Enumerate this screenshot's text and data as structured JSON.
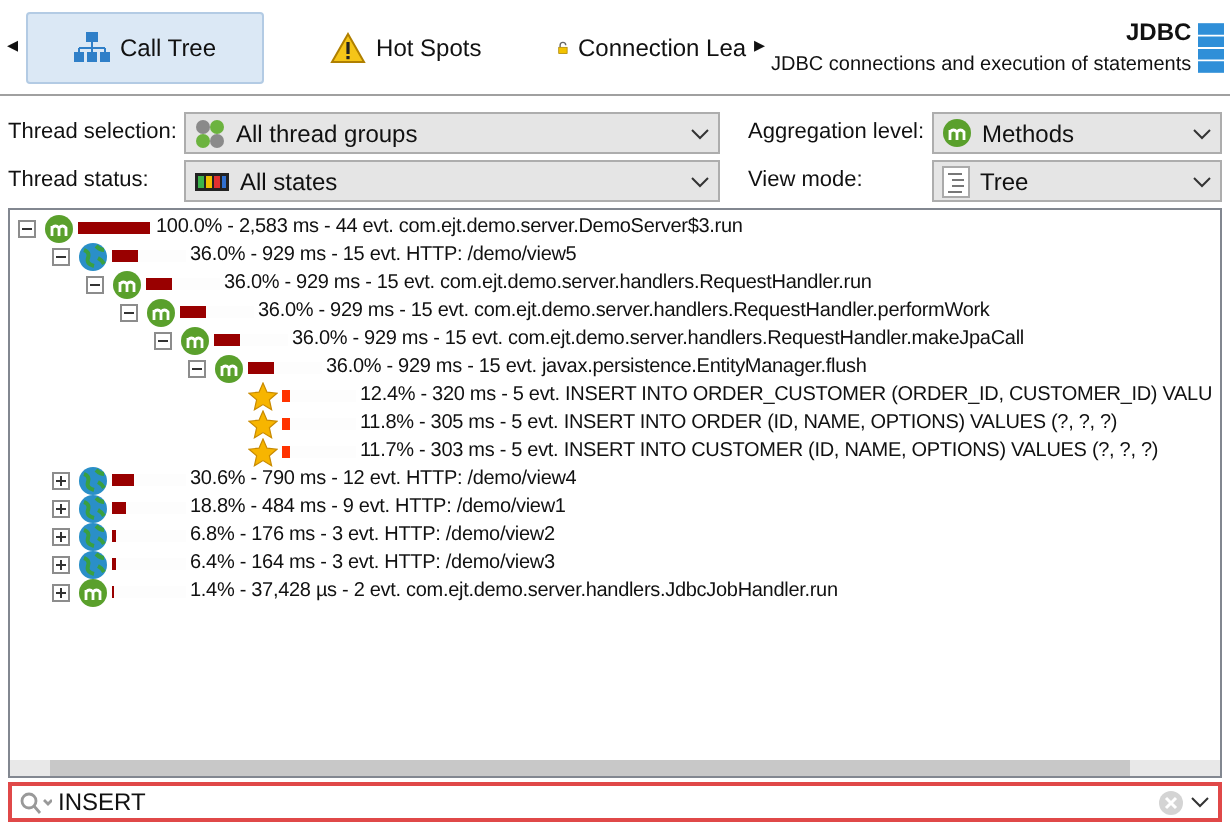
{
  "toolbar": {
    "scroll_left": "◂",
    "scroll_right": "▸",
    "tabs": [
      {
        "label": "Call Tree",
        "selected": true
      },
      {
        "label": "Hot Spots",
        "selected": false
      },
      {
        "label": "Connection Lea",
        "selected": false
      }
    ],
    "title": "JDBC",
    "subtitle": "JDBC connections and execution of statements"
  },
  "filters": [
    {
      "label": "Thread selection:",
      "value": "All thread groups"
    },
    {
      "label": "Aggregation level:",
      "value": "Methods"
    },
    {
      "label": "Thread status:",
      "value": "All states"
    },
    {
      "label": "View mode:",
      "value": "Tree"
    }
  ],
  "tree": [
    {
      "kind": "method",
      "level": 1.0,
      "text": "100.0% - 2,583 ms - 44 evt. com.ejt.demo.server.DemoServer$3.run",
      "expanded": true,
      "children": [
        {
          "kind": "http",
          "level": 0.36,
          "text": "36.0% - 929 ms - 15 evt. HTTP: /demo/view5",
          "expanded": true,
          "children": [
            {
              "kind": "method",
              "level": 0.36,
              "text": "36.0% - 929 ms - 15 evt. com.ejt.demo.server.handlers.RequestHandler.run",
              "expanded": true,
              "children": [
                {
                  "kind": "method",
                  "level": 0.36,
                  "text": "36.0% - 929 ms - 15 evt. com.ejt.demo.server.handlers.RequestHandler.performWork",
                  "expanded": true,
                  "children": [
                    {
                      "kind": "method",
                      "level": 0.36,
                      "text": "36.0% - 929 ms - 15 evt. com.ejt.demo.server.handlers.RequestHandler.makeJpaCall",
                      "expanded": true,
                      "children": [
                        {
                          "kind": "method",
                          "level": 0.36,
                          "text": "36.0% - 929 ms - 15 evt. javax.persistence.EntityManager.flush",
                          "expanded": true,
                          "children": [
                            {
                              "kind": "sql",
                              "level": 0.124,
                              "text": "12.4% - 320 ms - 5 evt. INSERT INTO ORDER_CUSTOMER (ORDER_ID, CUSTOMER_ID) VALU"
                            },
                            {
                              "kind": "sql",
                              "level": 0.118,
                              "text": "11.8% - 305 ms - 5 evt. INSERT INTO ORDER (ID, NAME, OPTIONS) VALUES (?, ?, ?)"
                            },
                            {
                              "kind": "sql",
                              "level": 0.117,
                              "text": "11.7% - 303 ms - 5 evt. INSERT INTO CUSTOMER (ID, NAME, OPTIONS) VALUES (?, ?, ?)"
                            }
                          ]
                        }
                      ]
                    }
                  ]
                }
              ]
            }
          ]
        },
        {
          "kind": "http",
          "level": 0.306,
          "text": "30.6% - 790 ms - 12 evt. HTTP: /demo/view4",
          "expanded": false
        },
        {
          "kind": "http",
          "level": 0.188,
          "text": "18.8% - 484 ms - 9 evt. HTTP: /demo/view1",
          "expanded": false
        },
        {
          "kind": "http",
          "level": 0.068,
          "text": "6.8% - 176 ms - 3 evt. HTTP: /demo/view2",
          "expanded": false
        },
        {
          "kind": "http",
          "level": 0.064,
          "text": "6.4% - 164 ms - 3 evt. HTTP: /demo/view3",
          "expanded": false
        },
        {
          "kind": "method",
          "level": 0.014,
          "text": "1.4% - 37,428 µs - 2 evt. com.ejt.demo.server.handlers.JdbcJobHandler.run",
          "expanded": false
        }
      ]
    }
  ],
  "search": {
    "value": "INSERT"
  }
}
